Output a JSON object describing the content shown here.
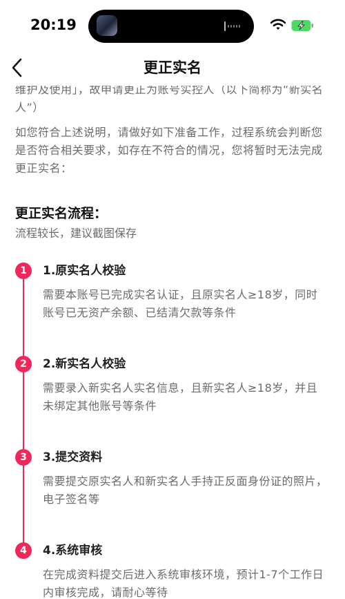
{
  "status_bar": {
    "time": "20:19"
  },
  "nav": {
    "title": "更正实名"
  },
  "intro": {
    "para_1": "维护及使用」，故申请更正为账号实控人（以下简称为“新实名人”）",
    "para_2": "如您符合上述说明，请做好如下准备工作，过程系统会判断您是否符合相关要求，如存在不符合的情况，您将暂时无法完成更正实名："
  },
  "process": {
    "title": "更正实名流程：",
    "subtitle": "流程较长，建议截图保存",
    "accent_color": "#f0285a",
    "steps": [
      {
        "number": "1",
        "title": "1.原实名人校验",
        "description": "需要本账号已完成实名认证，且原实名人≥18岁，同时账号已无资产余额、已结清欠款等条件"
      },
      {
        "number": "2",
        "title": "2.新实名人校验",
        "description": "需要录入新实名人实名信息，且新实名人≥18岁，并且未绑定其他账号等条件"
      },
      {
        "number": "3",
        "title": "3.提交资料",
        "description": "需要提交原实名人和新实名人手持正反面身份证的照片，电子签名等"
      },
      {
        "number": "4",
        "title": "4.系统审核",
        "description": "在完成资料提交后进入系统审核环境，预计1-7个工作日内审核完成，请耐心等待"
      }
    ]
  }
}
